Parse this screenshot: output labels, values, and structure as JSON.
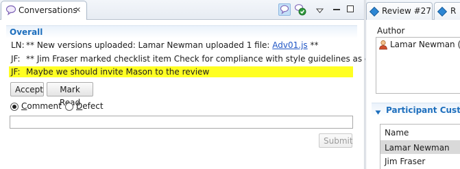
{
  "left_view": {
    "tab_title": "Conversations",
    "toolbar_icons": [
      "chat-bubble-icon",
      "checklist-icon",
      "view-menu-icon",
      "minimize-icon",
      "maximize-icon"
    ]
  },
  "overall": {
    "title": "Overall",
    "messages": [
      {
        "author": "LN:",
        "text_before": "** New versions uploaded: Lamar Newman uploaded 1 file: ",
        "link": "Adv01.js",
        "text_after": " **"
      },
      {
        "author": "JF:",
        "text": "** Jim Fraser marked checklist item Check for compliance with style guidelines as done **"
      },
      {
        "author": "JF:",
        "text": "Maybe we should invite Mason to the review",
        "highlight": "#ffff22"
      }
    ],
    "accept_label": "Accept",
    "mark_read_label": "Mark Read",
    "radio_comment_first": "C",
    "radio_comment_rest": "omment",
    "radio_defect_first": "D",
    "radio_defect_rest": "efect",
    "selected_type": "Comment",
    "comment_value": "",
    "submit_label": "Submit"
  },
  "right_view": {
    "tabs": [
      {
        "label": "Review #27",
        "icon": "review-diamond-icon"
      },
      {
        "label": "R",
        "icon": "review-diamond-icon"
      }
    ],
    "author_label": "Author",
    "author_entry": "Lamar Newman (LI",
    "participant_section_title": "Participant Custom",
    "table_header": "Name",
    "participants": [
      {
        "name": "Lamar Newman",
        "selected": true
      },
      {
        "name": "Jim Fraser",
        "selected": false
      }
    ]
  },
  "colors": {
    "section_title": "#1e6fbd",
    "highlight": "#ffff22",
    "link": "#1f55c5"
  }
}
